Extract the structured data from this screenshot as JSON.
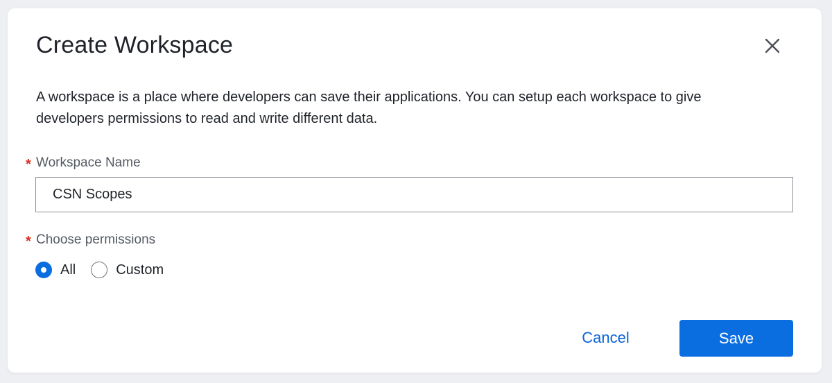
{
  "dialog": {
    "title": "Create Workspace",
    "close_icon": "close-icon",
    "description": "A workspace is a place where developers can save their applications. You can setup each workspace to give developers permissions to read and write different data."
  },
  "form": {
    "required_marker": "*",
    "workspace_name": {
      "label": "Workspace Name",
      "value": "CSN Scopes"
    },
    "permissions": {
      "label": "Choose permissions",
      "options": [
        {
          "label": "All",
          "selected": true
        },
        {
          "label": "Custom",
          "selected": false
        }
      ]
    }
  },
  "actions": {
    "cancel_label": "Cancel",
    "save_label": "Save"
  },
  "colors": {
    "accent": "#0a6ee0",
    "required": "#d93025",
    "text": "#1f2329",
    "label": "#555b63"
  }
}
